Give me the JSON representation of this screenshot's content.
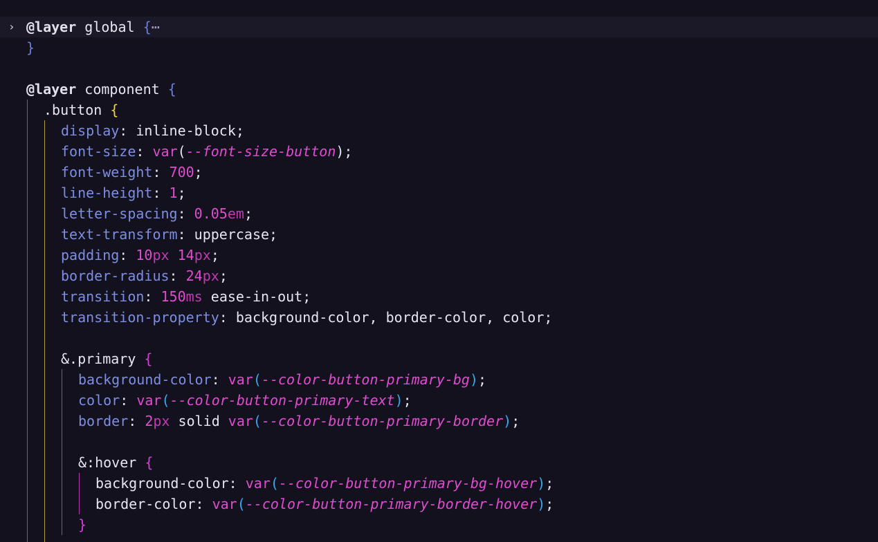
{
  "editor": {
    "language": "CSS",
    "lines": [
      {
        "fold": "›",
        "current": true,
        "indent": 0,
        "tokens": [
          [
            "kw",
            "@layer"
          ],
          [
            "sel",
            " global "
          ],
          [
            "br1",
            "{"
          ],
          [
            "dots",
            "⋯"
          ]
        ]
      },
      {
        "indent": 0,
        "tokens": [
          [
            "br1",
            "}"
          ]
        ]
      },
      {
        "indent": 0,
        "tokens": []
      },
      {
        "indent": 0,
        "tokens": [
          [
            "kw",
            "@layer"
          ],
          [
            "sel",
            " component "
          ],
          [
            "br1",
            "{"
          ]
        ]
      },
      {
        "indent": 1,
        "tokens": [
          [
            "sel",
            ".button "
          ],
          [
            "br2",
            "{"
          ]
        ]
      },
      {
        "indent": 2,
        "tokens": [
          [
            "prop",
            "display"
          ],
          [
            "punc",
            ": "
          ],
          [
            "val",
            "inline-block"
          ],
          [
            "punc",
            ";"
          ]
        ]
      },
      {
        "indent": 2,
        "tokens": [
          [
            "prop",
            "font-size"
          ],
          [
            "punc",
            ": "
          ],
          [
            "fn",
            "var"
          ],
          [
            "punc",
            "("
          ],
          [
            "cvar",
            "--font-size-button"
          ],
          [
            "punc",
            ");"
          ]
        ]
      },
      {
        "indent": 2,
        "tokens": [
          [
            "prop",
            "font-weight"
          ],
          [
            "punc",
            ": "
          ],
          [
            "num",
            "700"
          ],
          [
            "punc",
            ";"
          ]
        ]
      },
      {
        "indent": 2,
        "tokens": [
          [
            "prop",
            "line-height"
          ],
          [
            "punc",
            ": "
          ],
          [
            "num",
            "1"
          ],
          [
            "punc",
            ";"
          ]
        ]
      },
      {
        "indent": 2,
        "tokens": [
          [
            "prop",
            "letter-spacing"
          ],
          [
            "punc",
            ": "
          ],
          [
            "num",
            "0.05"
          ],
          [
            "unit",
            "em"
          ],
          [
            "punc",
            ";"
          ]
        ]
      },
      {
        "indent": 2,
        "tokens": [
          [
            "prop",
            "text-transform"
          ],
          [
            "punc",
            ": "
          ],
          [
            "val",
            "uppercase"
          ],
          [
            "punc",
            ";"
          ]
        ]
      },
      {
        "indent": 2,
        "tokens": [
          [
            "prop",
            "padding"
          ],
          [
            "punc",
            ": "
          ],
          [
            "num",
            "10"
          ],
          [
            "unit",
            "px"
          ],
          [
            "val",
            " "
          ],
          [
            "num",
            "14"
          ],
          [
            "unit",
            "px"
          ],
          [
            "punc",
            ";"
          ]
        ]
      },
      {
        "indent": 2,
        "tokens": [
          [
            "prop",
            "border-radius"
          ],
          [
            "punc",
            ": "
          ],
          [
            "num",
            "24"
          ],
          [
            "unit",
            "px"
          ],
          [
            "punc",
            ";"
          ]
        ]
      },
      {
        "indent": 2,
        "tokens": [
          [
            "prop",
            "transition"
          ],
          [
            "punc",
            ": "
          ],
          [
            "num",
            "150"
          ],
          [
            "unit",
            "ms"
          ],
          [
            "val",
            " ease-in-out"
          ],
          [
            "punc",
            ";"
          ]
        ]
      },
      {
        "indent": 2,
        "tokens": [
          [
            "prop",
            "transition-property"
          ],
          [
            "punc",
            ": "
          ],
          [
            "val",
            "background-color, border-color, color"
          ],
          [
            "punc",
            ";"
          ]
        ]
      },
      {
        "indent": 2,
        "tokens": []
      },
      {
        "indent": 2,
        "tokens": [
          [
            "sel",
            "&.primary "
          ],
          [
            "br3",
            "{"
          ]
        ]
      },
      {
        "indent": 3,
        "tokens": [
          [
            "prop",
            "background-color"
          ],
          [
            "punc",
            ": "
          ],
          [
            "fn",
            "var"
          ],
          [
            "br4",
            "("
          ],
          [
            "cvar",
            "--color-button-primary-bg"
          ],
          [
            "br4",
            ")"
          ],
          [
            "punc",
            ";"
          ]
        ]
      },
      {
        "indent": 3,
        "tokens": [
          [
            "prop",
            "color"
          ],
          [
            "punc",
            ": "
          ],
          [
            "fn",
            "var"
          ],
          [
            "br4",
            "("
          ],
          [
            "cvar",
            "--color-button-primary-text"
          ],
          [
            "br4",
            ")"
          ],
          [
            "punc",
            ";"
          ]
        ]
      },
      {
        "indent": 3,
        "tokens": [
          [
            "prop",
            "border"
          ],
          [
            "punc",
            ": "
          ],
          [
            "num",
            "2"
          ],
          [
            "unit",
            "px"
          ],
          [
            "val",
            " solid "
          ],
          [
            "fn",
            "var"
          ],
          [
            "br4",
            "("
          ],
          [
            "cvar",
            "--color-button-primary-border"
          ],
          [
            "br4",
            ")"
          ],
          [
            "punc",
            ";"
          ]
        ]
      },
      {
        "indent": 3,
        "tokens": []
      },
      {
        "indent": 3,
        "tokens": [
          [
            "sel",
            "&:hover "
          ],
          [
            "br3",
            "{"
          ]
        ]
      },
      {
        "indent": 4,
        "tokens": [
          [
            "prop2",
            "background-color"
          ],
          [
            "punc",
            ": "
          ],
          [
            "fn",
            "var"
          ],
          [
            "br4",
            "("
          ],
          [
            "cvar",
            "--color-button-primary-bg-hover"
          ],
          [
            "br4",
            ")"
          ],
          [
            "punc",
            ";"
          ]
        ]
      },
      {
        "indent": 4,
        "tokens": [
          [
            "prop2",
            "border-color"
          ],
          [
            "punc",
            ": "
          ],
          [
            "fn",
            "var"
          ],
          [
            "br4",
            "("
          ],
          [
            "cvar",
            "--color-button-primary-border-hover"
          ],
          [
            "br4",
            ")"
          ],
          [
            "punc",
            ";"
          ]
        ]
      },
      {
        "indent": 3,
        "tokens": [
          [
            "br3",
            "}"
          ]
        ]
      },
      {
        "indent": 2,
        "tokens": []
      }
    ]
  }
}
